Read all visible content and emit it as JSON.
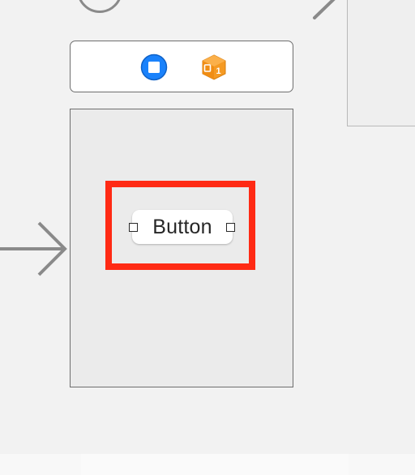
{
  "storyboard": {
    "button": {
      "label": "Button"
    },
    "dock": {
      "icons": [
        "view-controller-icon",
        "first-responder-icon"
      ],
      "first_responder_badge": "1"
    }
  },
  "colors": {
    "canvas_background": "#f2f2f2",
    "scene_background": "#ebebeb",
    "highlight": "#ff2a14",
    "view_controller_icon": "#1a82fb",
    "first_responder_icon": "#f59a23"
  }
}
